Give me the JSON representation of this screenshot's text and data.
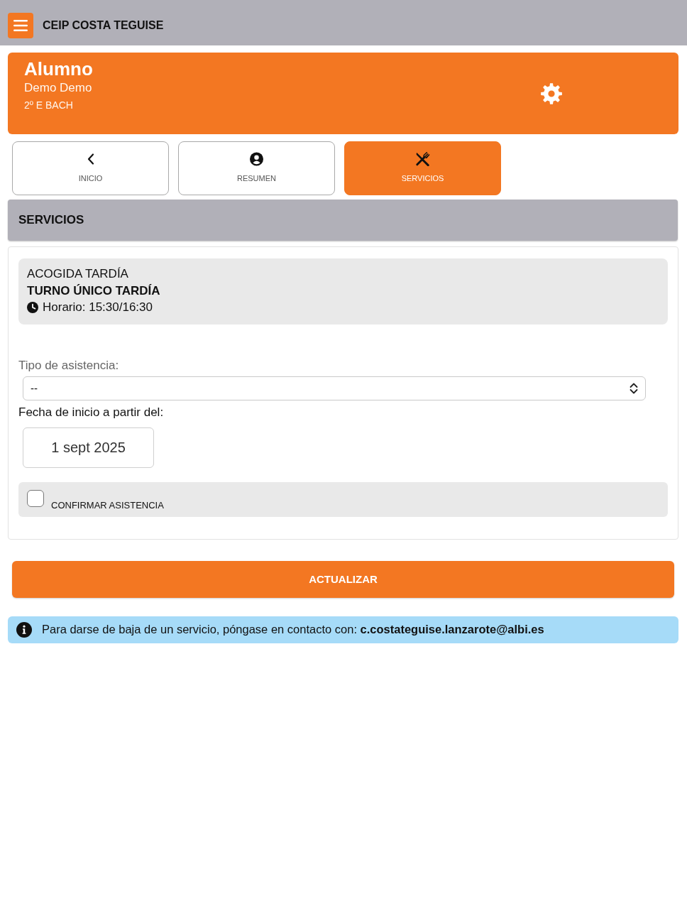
{
  "header": {
    "title": "CEIP COSTA TEGUISE"
  },
  "profile": {
    "title": "Alumno",
    "name": "Demo Demo",
    "group": "2º E BACH"
  },
  "tabs": [
    {
      "label": "INICIO",
      "kind": "back",
      "selected": false
    },
    {
      "label": "RESUMEN",
      "kind": "user",
      "selected": false
    },
    {
      "label": "SERVICIOS",
      "kind": "cutlery",
      "selected": true
    }
  ],
  "section": {
    "title": "SERVICIOS"
  },
  "service": {
    "name": "ACOGIDA TARDÍA",
    "shift": "TURNO ÚNICO TARDÍA",
    "schedule": "Horario: 15:30/16:30"
  },
  "form": {
    "type_label": "Tipo de asistencia:",
    "type_value": "--",
    "date_label": "Fecha de inicio a partir del:",
    "date_value": "1 sept 2025",
    "confirm": {
      "label": "CONFIRMAR ASISTENCIA",
      "checked": false
    }
  },
  "update_button": "ACTUALIZAR",
  "notice": "Para darse de baja de un servicio, póngase en contacto con: **c.costateguise.lanzarote@albi.es**"
}
